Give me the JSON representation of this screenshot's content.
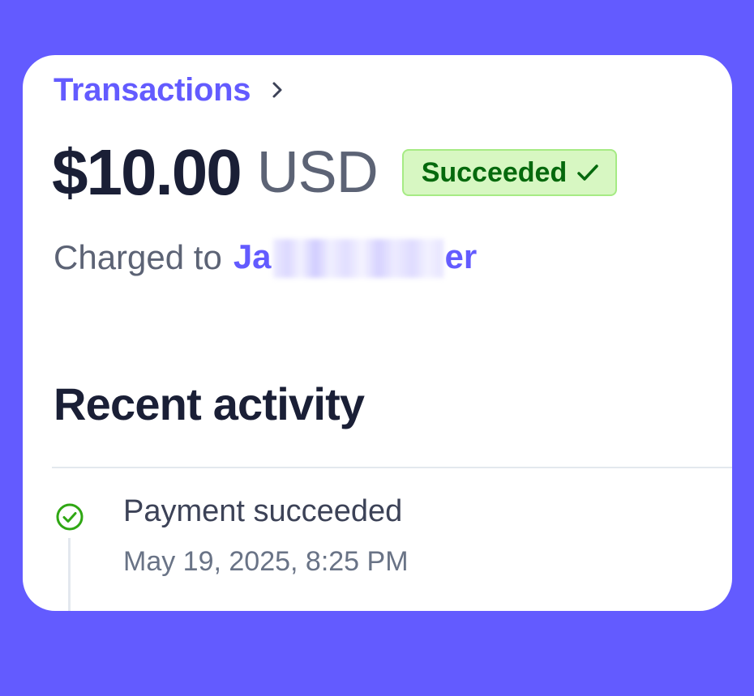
{
  "breadcrumb": {
    "label": "Transactions"
  },
  "payment": {
    "amount": "$10.00",
    "currency": "USD",
    "status": "Succeeded",
    "charged_prefix": "Charged to",
    "customer_start": "Ja",
    "customer_end": "er"
  },
  "activity": {
    "title": "Recent activity",
    "items": [
      {
        "label": "Payment succeeded",
        "time": "May 19, 2025, 8:25 PM",
        "icon": "check-circle-icon"
      }
    ]
  },
  "colors": {
    "background": "#635bff",
    "accent": "#635bff",
    "success_text": "#05690d",
    "success_bg": "#d7f7c2",
    "success_border": "#a6eb84",
    "success_icon": "#2fa713"
  }
}
